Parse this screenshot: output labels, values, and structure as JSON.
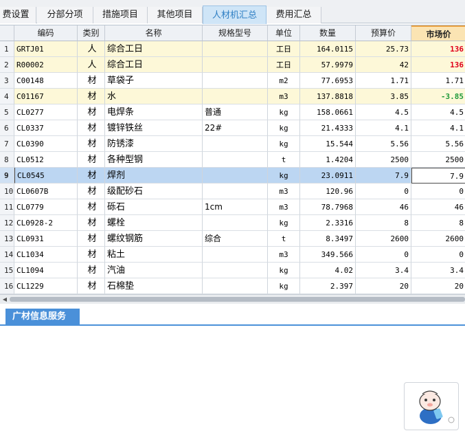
{
  "tabs": [
    "取费设置",
    "分部分项",
    "措施项目",
    "其他项目",
    "人材机汇总",
    "费用汇总"
  ],
  "tabs_visible": [
    "费设置",
    "分部分项",
    "措施项目",
    "其他项目",
    "人材机汇总",
    "费用汇总"
  ],
  "active_tab": "人材机汇总",
  "columns": [
    "",
    "编码",
    "类别",
    "名称",
    "规格型号",
    "单位",
    "数量",
    "预算价",
    "市场价"
  ],
  "rows": [
    {
      "num": "1",
      "code": "GRTJ01",
      "type": "人",
      "name": "综合工日",
      "spec": "",
      "unit": "工日",
      "qty": "164.0115",
      "budget": "25.73",
      "market": "136",
      "hl": true,
      "market_style": "red"
    },
    {
      "num": "2",
      "code": "R00002",
      "type": "人",
      "name": "综合工日",
      "spec": "",
      "unit": "工日",
      "qty": "57.9979",
      "budget": "42",
      "market": "136",
      "hl": true,
      "market_style": "red"
    },
    {
      "num": "3",
      "code": "C00148",
      "type": "材",
      "name": "草袋子",
      "spec": "",
      "unit": "m2",
      "qty": "77.6953",
      "budget": "1.71",
      "market": "1.71"
    },
    {
      "num": "4",
      "code": "C01167",
      "type": "材",
      "name": "水",
      "spec": "",
      "unit": "m3",
      "qty": "137.8818",
      "budget": "3.85",
      "market": "-3.85",
      "hl": true,
      "market_style": "green"
    },
    {
      "num": "5",
      "code": "CL0277",
      "type": "材",
      "name": "电焊条",
      "spec": "普通",
      "unit": "kg",
      "qty": "158.0661",
      "budget": "4.5",
      "market": "4.5"
    },
    {
      "num": "6",
      "code": "CL0337",
      "type": "材",
      "name": "镀锌铁丝",
      "spec": "22#",
      "unit": "kg",
      "qty": "21.4333",
      "budget": "4.1",
      "market": "4.1"
    },
    {
      "num": "7",
      "code": "CL0390",
      "type": "材",
      "name": "防锈漆",
      "spec": "",
      "unit": "kg",
      "qty": "15.544",
      "budget": "5.56",
      "market": "5.56"
    },
    {
      "num": "8",
      "code": "CL0512",
      "type": "材",
      "name": "各种型钢",
      "spec": "",
      "unit": "t",
      "qty": "1.4204",
      "budget": "2500",
      "market": "2500"
    },
    {
      "num": "9",
      "code": "CL0545",
      "type": "材",
      "name": "焊剂",
      "spec": "",
      "unit": "kg",
      "qty": "23.0911",
      "budget": "7.9",
      "market": "7.9",
      "selected": true
    },
    {
      "num": "10",
      "code": "CL0607B",
      "type": "材",
      "name": "级配砂石",
      "spec": "",
      "unit": "m3",
      "qty": "120.96",
      "budget": "0",
      "market": "0"
    },
    {
      "num": "11",
      "code": "CL0779",
      "type": "材",
      "name": "砾石",
      "spec": "1cm",
      "unit": "m3",
      "qty": "78.7968",
      "budget": "46",
      "market": "46"
    },
    {
      "num": "12",
      "code": "CL0928-2",
      "type": "材",
      "name": "螺栓",
      "spec": "",
      "unit": "kg",
      "qty": "2.3316",
      "budget": "8",
      "market": "8"
    },
    {
      "num": "13",
      "code": "CL0931",
      "type": "材",
      "name": "螺纹钢筋",
      "spec": "综合",
      "unit": "t",
      "qty": "8.3497",
      "budget": "2600",
      "market": "2600"
    },
    {
      "num": "14",
      "code": "CL1034",
      "type": "材",
      "name": "粘土",
      "spec": "",
      "unit": "m3",
      "qty": "349.566",
      "budget": "0",
      "market": "0"
    },
    {
      "num": "15",
      "code": "CL1094",
      "type": "材",
      "name": "汽油",
      "spec": "",
      "unit": "kg",
      "qty": "4.02",
      "budget": "3.4",
      "market": "3.4"
    },
    {
      "num": "16",
      "code": "CL1229",
      "type": "材",
      "name": "石棉垫",
      "spec": "",
      "unit": "kg",
      "qty": "2.397",
      "budget": "20",
      "market": "20"
    }
  ],
  "bottom_tab": "广材信息服务",
  "icons": {
    "scroll_left": "triangle-left-icon",
    "mascot": "mascot-icon"
  }
}
